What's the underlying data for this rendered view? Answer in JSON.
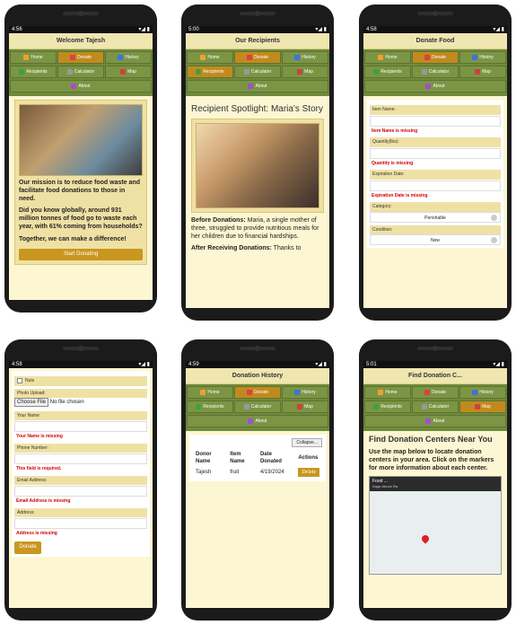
{
  "nav": {
    "home": "Home",
    "donate": "Donate",
    "history": "History",
    "recipients": "Recipients",
    "calculator": "Calculator",
    "map": "Map",
    "about": "About"
  },
  "phone1": {
    "status": "4:56",
    "title": "Welcome Tajesh",
    "mission": "Our mission is to reduce food waste and facilitate food donations to those in need.",
    "stat": "Did you know globally, around 931 million tonnes of food go to waste each year, with 61% coming from households?",
    "together": "Together, we can make a difference!",
    "button": "Start Donating"
  },
  "phone2": {
    "status": "5:00",
    "title": "Our Recipients",
    "heading": "Recipient Spotlight: Maria's Story",
    "before_label": "Before Donations:",
    "before_text": " Maria, a single mother of three, struggled to provide nutritious meals for her children due to financial hardships.",
    "after_label": "After Receiving Donations:",
    "after_text": " Thanks to"
  },
  "phone3": {
    "status": "4:58",
    "title": "Donate Food",
    "item_label": "Item Name:",
    "item_error": "Item Name is missing",
    "qty_label": "Quantity(lbs):",
    "qty_error": "Quantity is missing",
    "exp_label": "Expiration Date:",
    "exp_error": "Expiration Date is missing",
    "cat_label": "Category:",
    "cat_value": "Perishable",
    "cond_label": "Condition:",
    "cond_value": "New"
  },
  "phone4": {
    "status": "4:58",
    "nuts": "Nuts",
    "photo_label": "Photo Upload:",
    "choose": "Choose File",
    "nofile": "No file chosen",
    "name_label": "Your Name:",
    "name_error": "Your Name is missing",
    "phone_label": "Phone Number:",
    "phone_error": "This field is required.",
    "email_label": "Email Address:",
    "email_error": "Email Address is missing",
    "addr_label": "Address:",
    "addr_error": "Address is missing",
    "donate": "Donate"
  },
  "phone5": {
    "status": "4:59",
    "title": "Donation History",
    "collapse": "Collapse...",
    "headers": [
      "Donor Name",
      "Item Name",
      "Date Donated",
      "Actions"
    ],
    "row": {
      "donor": "Tajesh",
      "item": "fruit",
      "date": "4/19/2024",
      "action": "Delete"
    }
  },
  "phone6": {
    "status": "5:01",
    "title": "Find Donation C...",
    "heading": "Find Donation Centers Near You",
    "desc": "Use the map below to locate donation centers in your area. Click on the markers for more information about each center.",
    "map_title": "Food ...",
    "map_sub": "Dage Above Ra"
  },
  "colors": {
    "accent": "#c9961f",
    "nav": "#6f8a3c",
    "bg": "#fdf6d2",
    "error": "#d00000"
  }
}
